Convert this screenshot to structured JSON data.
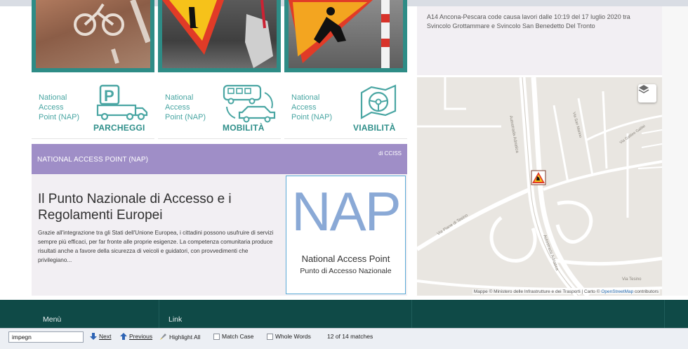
{
  "tiles": [
    {
      "label_line1": "National",
      "label_line2": "Access",
      "label_line3": "Point (NAP)",
      "title": "PARCHEGGI",
      "icon": "parking-truck-icon"
    },
    {
      "label_line1": "National",
      "label_line2": "Access",
      "label_line3": "Point (NAP)",
      "title": "MOBILITÀ",
      "icon": "bus-car-icon"
    },
    {
      "label_line1": "National",
      "label_line2": "Access",
      "label_line3": "Point (NAP)",
      "title": "VIABILITÀ",
      "icon": "steering-road-icon"
    }
  ],
  "info": {
    "text": "A14 Ancona-Pescara code causa lavori dalle 10:19 del 17 luglio 2020 tra Svincolo Grottammare e Svincolo San Benedetto Del Tronto"
  },
  "map": {
    "attribution_prefix": "Mappe © Ministero delle Infrastrutture e dei Trasporti | Carto ©",
    "attribution_link": "OpenStreetMap",
    "attribution_suffix": "contributors",
    "road_labels": [
      "Autostrada Adriatica",
      "Via Piane di Tesino",
      "Via San Marino",
      "Via Galileo Galilei",
      "Via Tesino"
    ],
    "layers_icon": "layers-icon"
  },
  "nap": {
    "header_title": "NATIONAL ACCESS POINT (NAP)",
    "header_by": "di CCISS",
    "title": "Il Punto Nazionale di Accesso e i Regolamenti Europei",
    "body": "Grazie all'integrazione tra gli Stati dell'Unione Europea, i cittadini possono usufruire di servizi sempre più efficaci, per far fronte alle proprie esigenze. La competenza comunitaria produce risultati anche a favore della sicurezza di veicoli e guidatori, con provvedimenti che privilegiano...",
    "logo_big": "NAP",
    "logo_line1": "National Access Point",
    "logo_line2": "Punto di Accesso Nazionale"
  },
  "footer": {
    "menu_label": "Menù",
    "link_label": "Link"
  },
  "findbar": {
    "query": "impegn",
    "next_label": "Next",
    "previous_label": "Previous",
    "highlight_label": "Highlight All",
    "match_case_label": "Match Case",
    "whole_words_label": "Whole Words",
    "matches_text": "12 of 14 matches"
  }
}
